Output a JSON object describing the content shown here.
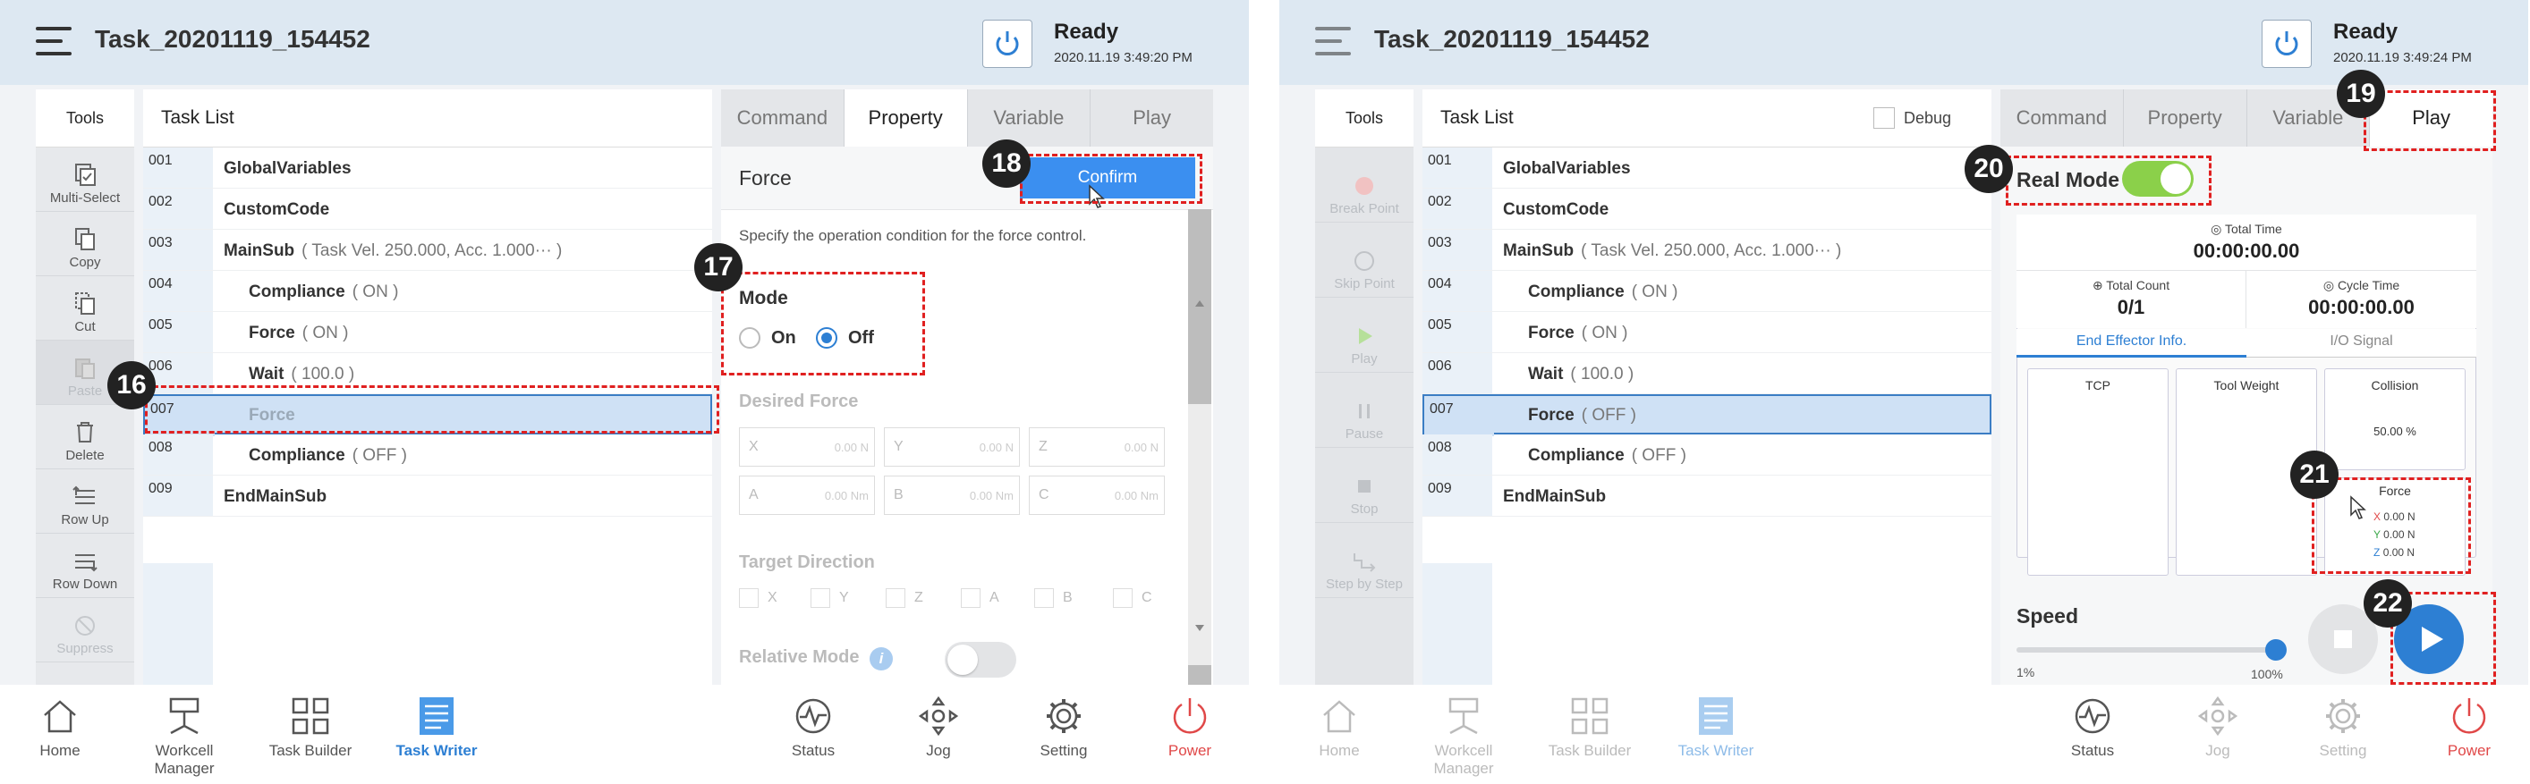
{
  "left": {
    "task_title": "Task_20201119_154452",
    "status": "Ready",
    "timestamp": "2020.11.19 3:49:20 PM",
    "tools_title": "Tools",
    "tools": [
      "Multi-Select",
      "Copy",
      "Cut",
      "Paste",
      "Delete",
      "Row Up",
      "Row Down",
      "Suppress"
    ],
    "tasklist_title": "Task List",
    "rows": [
      {
        "num": "001",
        "text": "GlobalVariables",
        "param": ""
      },
      {
        "num": "002",
        "text": "CustomCode",
        "param": ""
      },
      {
        "num": "003",
        "text": "MainSub",
        "param": "( Task Vel. 250.000, Acc. 1.000··· )"
      },
      {
        "num": "004",
        "text": "Compliance",
        "param": "( ON )"
      },
      {
        "num": "005",
        "text": "Force",
        "param": "( ON )"
      },
      {
        "num": "006",
        "text": "Wait",
        "param": "( 100.0 )"
      },
      {
        "num": "007",
        "text": "Force",
        "param": ""
      },
      {
        "num": "008",
        "text": "Compliance",
        "param": "( OFF )"
      },
      {
        "num": "009",
        "text": "EndMainSub",
        "param": ""
      }
    ],
    "tabs": [
      "Command",
      "Property",
      "Variable",
      "Play"
    ],
    "panel_title": "Force",
    "confirm_label": "Confirm",
    "description": "Specify the operation condition for the force control.",
    "mode_label": "Mode",
    "mode_on": "On",
    "mode_off": "Off",
    "desired_force_label": "Desired Force",
    "fields": [
      {
        "axis": "X",
        "value": "0.00 N"
      },
      {
        "axis": "Y",
        "value": "0.00 N"
      },
      {
        "axis": "Z",
        "value": "0.00 N"
      },
      {
        "axis": "A",
        "value": "0.00 Nm"
      },
      {
        "axis": "B",
        "value": "0.00 Nm"
      },
      {
        "axis": "C",
        "value": "0.00 Nm"
      }
    ],
    "target_direction_label": "Target Direction",
    "directions": [
      "X",
      "Y",
      "Z",
      "A",
      "B",
      "C"
    ],
    "relative_mode_label": "Relative Mode",
    "info_glyph": "i",
    "badges": [
      "16",
      "17",
      "18"
    ]
  },
  "right": {
    "task_title": "Task_20201119_154452",
    "status": "Ready",
    "timestamp": "2020.11.19 3:49:24 PM",
    "tools_title": "Tools",
    "tools": [
      "Break Point",
      "Skip Point",
      "Play",
      "Pause",
      "Stop",
      "Step by Step"
    ],
    "tasklist_title": "Task List",
    "debug_label": "Debug",
    "rows": [
      {
        "num": "001",
        "text": "GlobalVariables",
        "param": ""
      },
      {
        "num": "002",
        "text": "CustomCode",
        "param": ""
      },
      {
        "num": "003",
        "text": "MainSub",
        "param": "( Task Vel. 250.000, Acc. 1.000··· )"
      },
      {
        "num": "004",
        "text": "Compliance",
        "param": "( ON )"
      },
      {
        "num": "005",
        "text": "Force",
        "param": "( ON )"
      },
      {
        "num": "006",
        "text": "Wait",
        "param": "( 100.0 )"
      },
      {
        "num": "007",
        "text": "Force",
        "param": "( OFF )"
      },
      {
        "num": "008",
        "text": "Compliance",
        "param": "( OFF )"
      },
      {
        "num": "009",
        "text": "EndMainSub",
        "param": ""
      }
    ],
    "tabs": [
      "Command",
      "Property",
      "Variable",
      "Play"
    ],
    "real_mode_label": "Real Mode",
    "total_time_label": "Total Time",
    "total_time": "00:00:00.00",
    "total_count_label": "Total Count",
    "total_count": "0/1",
    "cycle_time_label": "Cycle Time",
    "cycle_time": "00:00:00.00",
    "subtab_effector": "End Effector Info.",
    "subtab_io": "I/O Signal",
    "tcp_label": "TCP",
    "tool_weight_label": "Tool Weight",
    "collision_label": "Collision",
    "collision_value": "50.00 %",
    "force_label": "Force",
    "force_x": "0.00 N",
    "force_y": "0.00 N",
    "force_z": "0.00 N",
    "axis_x": "X",
    "axis_y": "Y",
    "axis_z": "Z",
    "speed_label": "Speed",
    "speed_min": "1%",
    "speed_max": "100%",
    "speed_fraction": 1.0,
    "badges": [
      "19",
      "20",
      "21",
      "22"
    ]
  },
  "nav": [
    "Home",
    "Workcell Manager",
    "Task Builder",
    "Task Writer",
    "Status",
    "Jog",
    "Setting",
    "Power"
  ],
  "colors": {
    "accent": "#2d7fd3",
    "confirm": "#3b8ff0",
    "annotation": "#e02020",
    "toggle_on": "#8bd04a",
    "power": "#e04848"
  }
}
